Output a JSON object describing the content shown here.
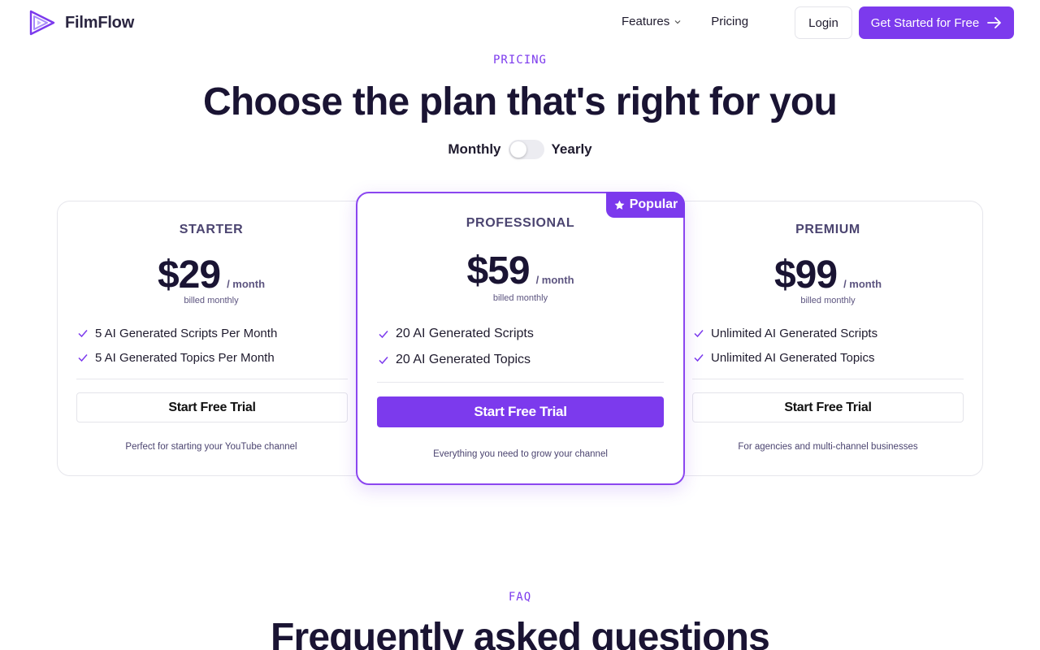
{
  "brand": {
    "name": "FilmFlow",
    "accent": "#7c3aed"
  },
  "nav": {
    "links": [
      {
        "label": "Features",
        "has_dropdown": true,
        "icon": "chevron-down-icon"
      },
      {
        "label": "Pricing",
        "has_dropdown": false
      }
    ],
    "login_label": "Login",
    "cta_label": "Get Started for Free",
    "cta_icon": "arrow-right-icon"
  },
  "pricing": {
    "eyebrow": "PRICING",
    "title": "Choose the plan that's right for you",
    "toggle": {
      "left": "Monthly",
      "right": "Yearly",
      "state": "Monthly"
    },
    "plans": [
      {
        "name": "STARTER",
        "price": "$29",
        "period": "/ month",
        "billing": "billed monthly",
        "features": [
          "5 AI Generated Scripts Per Month",
          "5 AI Generated Topics Per Month"
        ],
        "button": "Start Free Trial",
        "tagline": "Perfect for starting your YouTube channel"
      },
      {
        "name": "PROFESSIONAL",
        "price": "$59",
        "period": "/ month",
        "billing": "billed monthly",
        "features": [
          "20 AI Generated Scripts",
          "20 AI Generated Topics"
        ],
        "button": "Start Free Trial",
        "tagline": "Everything you need to grow your channel",
        "badge": "Popular",
        "badge_icon": "star-icon"
      },
      {
        "name": "PREMIUM",
        "price": "$99",
        "period": "/ month",
        "billing": "billed monthly",
        "features": [
          "Unlimited AI Generated Scripts",
          "Unlimited AI Generated Topics"
        ],
        "button": "Start Free Trial",
        "tagline": "For agencies and multi-channel businesses"
      }
    ]
  },
  "faq": {
    "eyebrow": "FAQ",
    "title": "Frequently asked questions"
  }
}
